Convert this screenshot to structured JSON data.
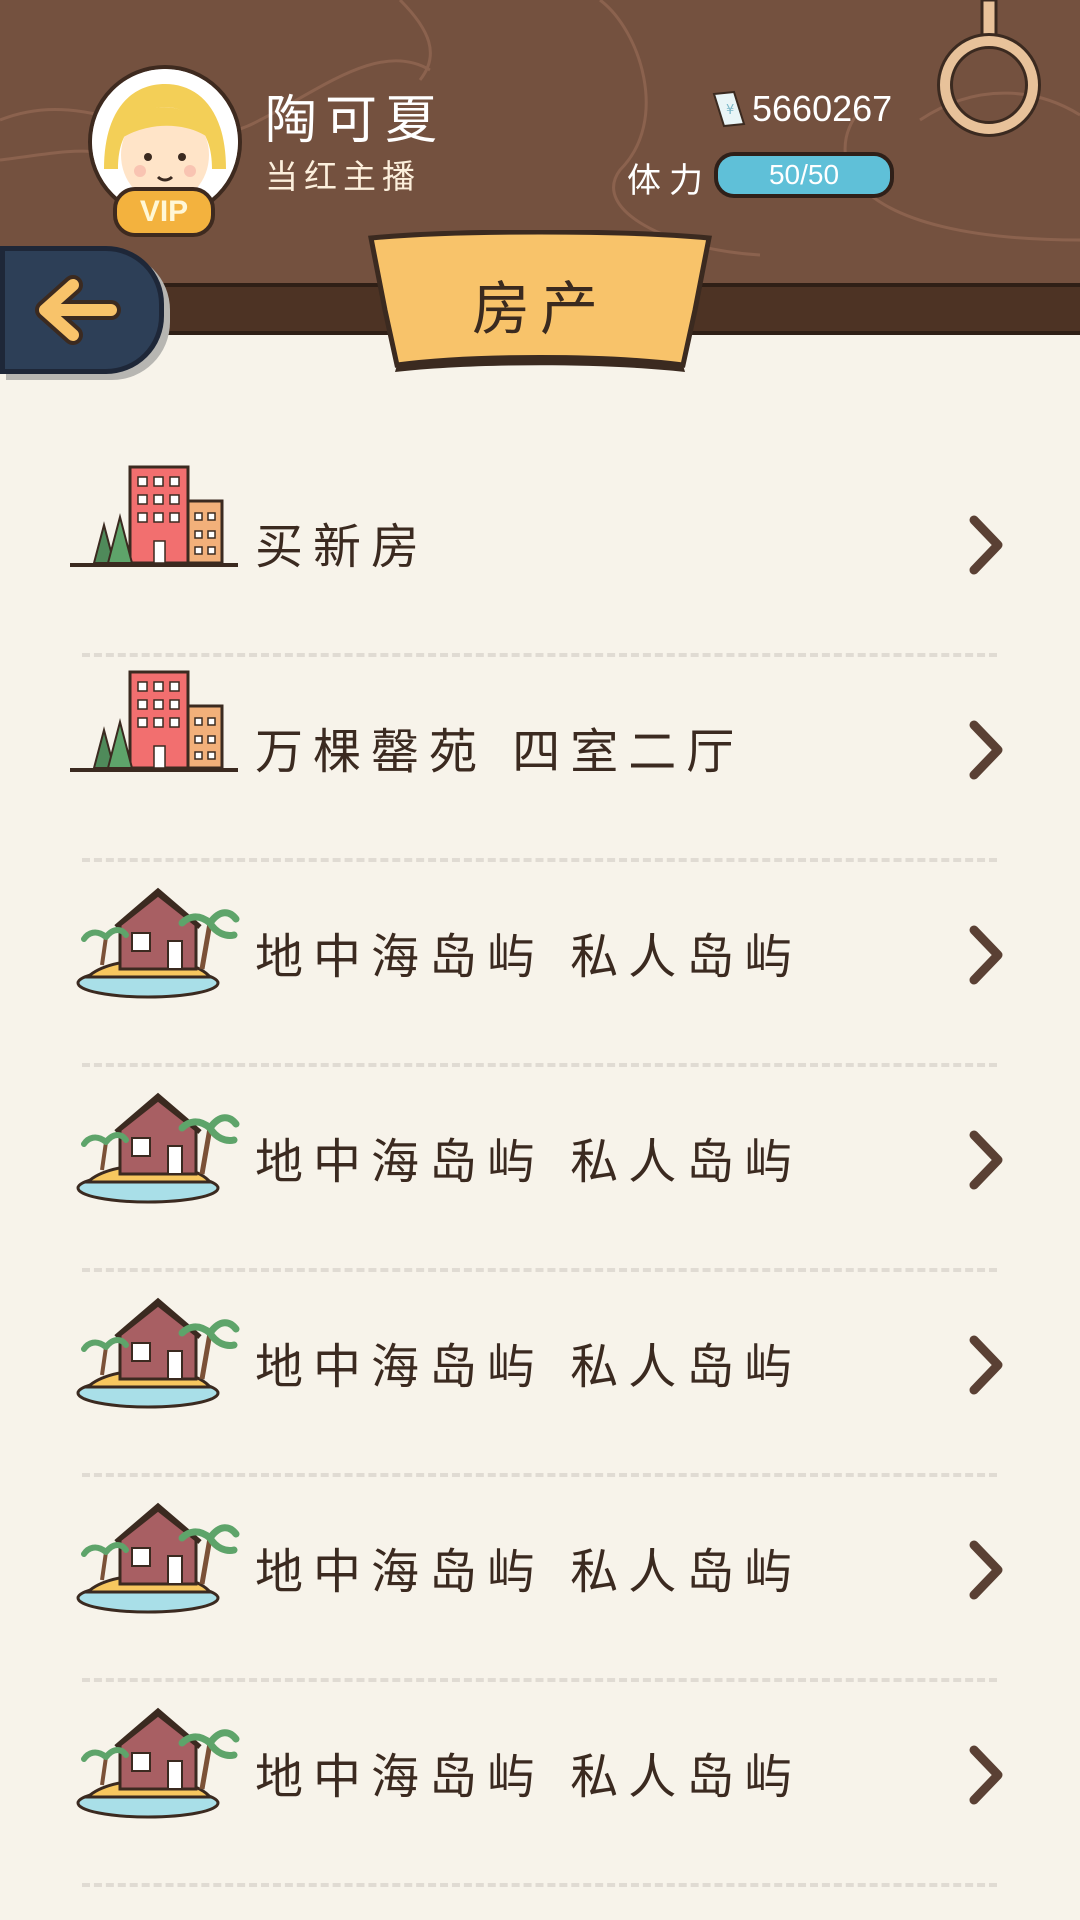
{
  "profile": {
    "name": "陶可夏",
    "title": "当红主播",
    "vip_label": "VIP"
  },
  "stats": {
    "cash": "5660267",
    "stamina_label": "体力",
    "stamina_text": "50/50",
    "stamina_fraction": 1.0
  },
  "page": {
    "title": "房产"
  },
  "items": [
    {
      "label": "买新房",
      "icon": "apartment-building-icon"
    },
    {
      "label": "万棵罄苑  四室二厅",
      "icon": "apartment-building-icon"
    },
    {
      "label": "地中海岛屿  私人岛屿",
      "icon": "island-house-icon"
    },
    {
      "label": "地中海岛屿  私人岛屿",
      "icon": "island-house-icon"
    },
    {
      "label": "地中海岛屿  私人岛屿",
      "icon": "island-house-icon"
    },
    {
      "label": "地中海岛屿  私人岛屿",
      "icon": "island-house-icon"
    },
    {
      "label": "地中海岛屿  私人岛屿",
      "icon": "island-house-icon"
    }
  ],
  "colors": {
    "header_wood": "#74513f",
    "background": "#f7f3ea",
    "banner": "#f8c36a",
    "stamina_fill": "#5fc0d8",
    "back_button": "#2d3f57",
    "vip_badge": "#f3b23e"
  }
}
